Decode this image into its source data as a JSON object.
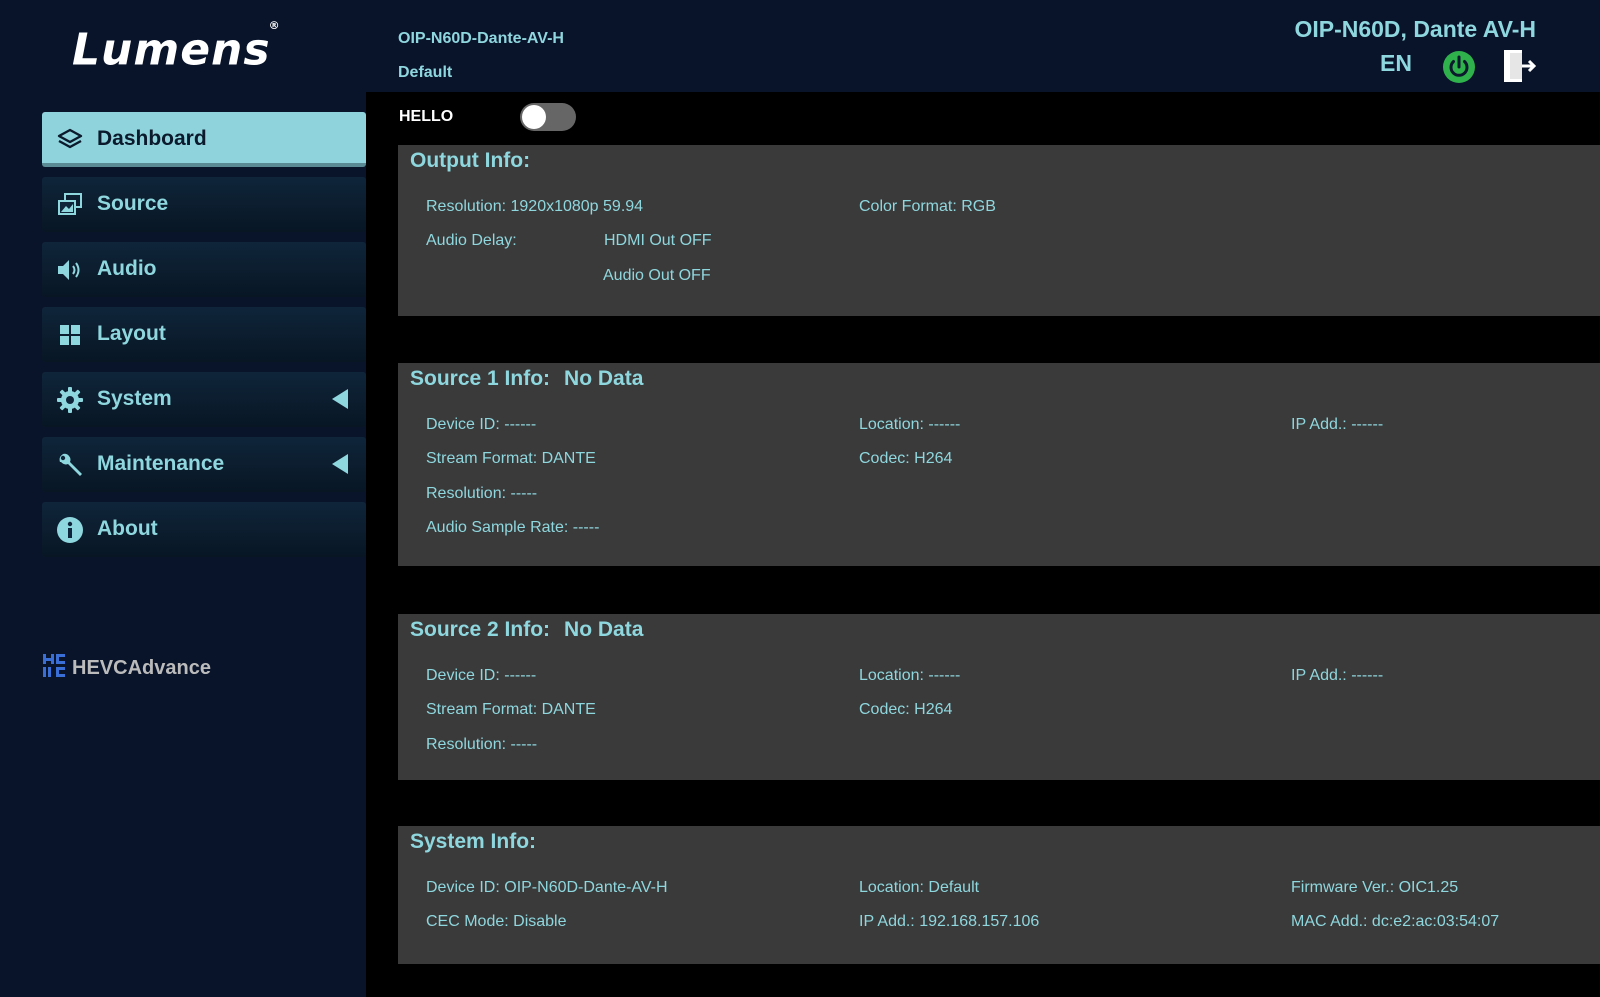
{
  "app": {
    "logo_text": "Lumens",
    "logo_mark": "®",
    "partner_logo": "HEVCAdvance™"
  },
  "header": {
    "device_name": "OIP-N60D-Dante-AV-H",
    "location": "Default",
    "model_title": "OIP-N60D, Dante AV-H",
    "language": "EN"
  },
  "sidebar": {
    "items": [
      {
        "label": "Dashboard",
        "icon": "layers-icon",
        "active": true
      },
      {
        "label": "Source",
        "icon": "source-icon"
      },
      {
        "label": "Audio",
        "icon": "speaker-icon"
      },
      {
        "label": "Layout",
        "icon": "grid-icon"
      },
      {
        "label": "System",
        "icon": "gear-icon",
        "expandable": true
      },
      {
        "label": "Maintenance",
        "icon": "wrench-icon",
        "expandable": true
      },
      {
        "label": "About",
        "icon": "info-icon"
      }
    ]
  },
  "hello": {
    "label": "HELLO",
    "enabled": false
  },
  "output_info": {
    "title": "Output Info:",
    "resolution": "Resolution: 1920x1080p 59.94",
    "color_format": "Color Format: RGB",
    "audio_delay_label": "Audio Delay:",
    "hdmi_out": "HDMI Out OFF",
    "audio_out": "Audio Out OFF"
  },
  "source1": {
    "title": "Source 1 Info:",
    "status": "No Data",
    "device_id": "Device ID: ------",
    "location": "Location: ------",
    "ip": "IP Add.: ------",
    "stream_format": "Stream Format: DANTE",
    "codec": "Codec: H264",
    "resolution": "Resolution: -----",
    "sample_rate": "Audio Sample Rate: -----"
  },
  "source2": {
    "title": "Source 2 Info:",
    "status": "No Data",
    "device_id": "Device ID: ------",
    "location": "Location: ------",
    "ip": "IP Add.: ------",
    "stream_format": "Stream Format: DANTE",
    "codec": "Codec: H264",
    "resolution": "Resolution: -----"
  },
  "system_info": {
    "title": "System Info:",
    "device_id": "Device ID: OIP-N60D-Dante-AV-H",
    "location": "Location: Default",
    "firmware": "Firmware Ver.: OIC1.25",
    "cec_mode": "CEC Mode: Disable",
    "ip": "IP Add.: 192.168.157.106",
    "mac": "MAC Add.: dc:e2:ac:03:54:07"
  },
  "colors": {
    "accent": "#8fd7de",
    "sidebar_bg": "#09142b",
    "panel_bg": "#3a3a3a",
    "power_green": "#2fb24c"
  }
}
